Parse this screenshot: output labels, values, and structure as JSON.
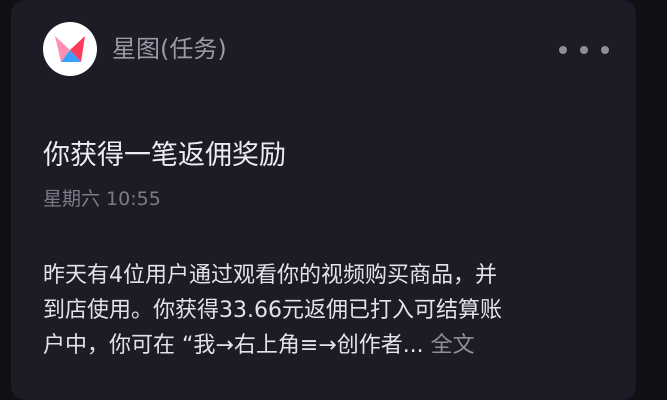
{
  "sender": {
    "name": "星图(任务)",
    "logo": "xingtu-logo-icon",
    "more": "more-options-icon"
  },
  "message": {
    "title": "你获得一笔返佣奖励",
    "time": "星期六 10:55",
    "body_lines": [
      "昨天有4位用户通过观看你的视频购买商品，并",
      "到店使用。你获得33.66元返佣已打入可结算账",
      "户中，你可在 “我→右上角≡→创作者... "
    ],
    "full_text_link": "全文"
  },
  "colors": {
    "background": "#0f0f14",
    "card": "#1c1c26",
    "logo_red": "#ff3b5c",
    "logo_blue": "#3aa0ff",
    "logo_pink": "#ff8fb0"
  }
}
